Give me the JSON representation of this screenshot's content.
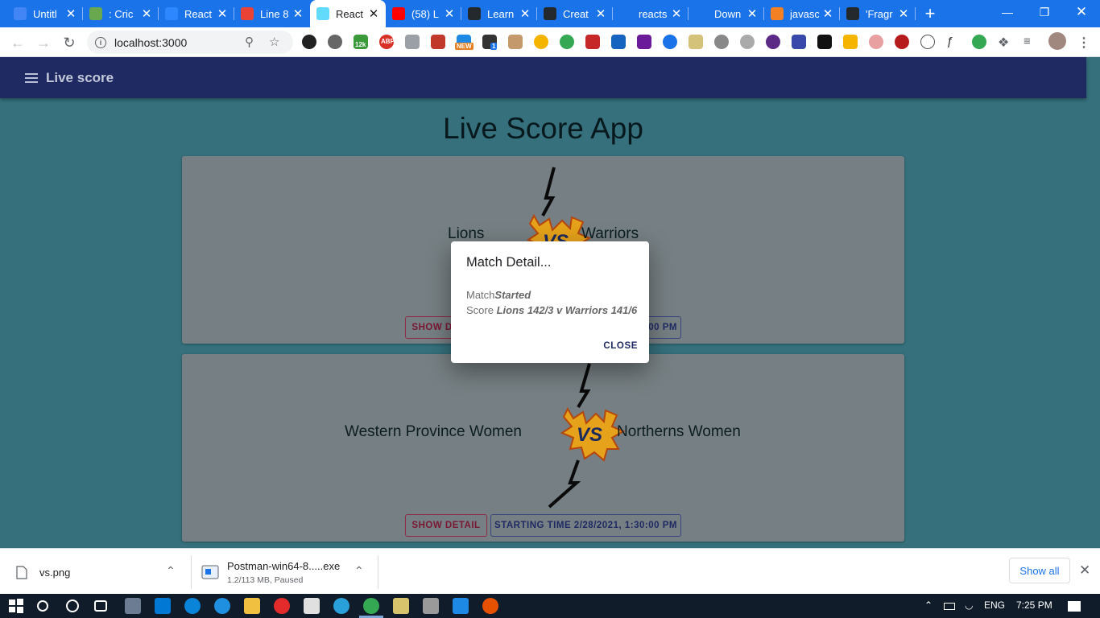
{
  "browser": {
    "tabs": [
      {
        "title": "Untitl",
        "icon": "docs-icon",
        "color": "#4285f4"
      },
      {
        "title": ": Cric",
        "icon": "cricket-icon",
        "color": "#6aa84f"
      },
      {
        "title": "React",
        "icon": "react-blue-icon",
        "color": "#2d88ff"
      },
      {
        "title": "Line 8",
        "icon": "google-icon",
        "color": "#ea4335"
      },
      {
        "title": "React",
        "icon": "react-icon",
        "color": "#61dafb"
      },
      {
        "title": "(58) L",
        "icon": "youtube-icon",
        "color": "#ff0000"
      },
      {
        "title": "Learn",
        "icon": "github-icon",
        "color": "#24292e"
      },
      {
        "title": "Creat",
        "icon": "github-icon",
        "color": "#24292e"
      },
      {
        "title": "reacts",
        "icon": "blank-icon",
        "color": "#1a73e8"
      },
      {
        "title": "Down",
        "icon": "person-icon",
        "color": "#1a73e8"
      },
      {
        "title": "javasc",
        "icon": "stack-icon",
        "color": "#f48024"
      },
      {
        "title": "'Fragr",
        "icon": "github-icon",
        "color": "#24292e"
      }
    ],
    "active_tab": 4,
    "close_symbol": "✕",
    "new_tab": "+",
    "url": "localhost:3000",
    "ext_badges": {
      "counter": "12k",
      "abp": "ABP",
      "new": "NEW",
      "one": "1"
    }
  },
  "app": {
    "bar_title": "Live score",
    "page_title": "Live Score App",
    "matches": [
      {
        "team1": "Lions",
        "team2": "Warriors",
        "detail_button": "SHOW DETAIL",
        "time_button": "STARTING TIME 2/28/2021, 1:30:00 PM"
      },
      {
        "team1": "Western Province Women",
        "team2": "Northerns Women",
        "detail_button": "SHOW DETAIL",
        "time_button": "STARTING TIME 2/28/2021, 1:30:00 PM"
      }
    ],
    "vs_text": "VS",
    "dialog": {
      "title": "Match Detail...",
      "match_label": "Match",
      "match_value": "Started",
      "score_label": "Score",
      "score_value": "Lions 142/3 v Warriors 141/6",
      "close_label": "CLOSE"
    }
  },
  "downloads": {
    "items": [
      {
        "name": "vs.png",
        "status": ""
      },
      {
        "name": "Postman-win64-8.....exe",
        "status": "1.2/113 MB, Paused"
      }
    ],
    "show_all": "Show all"
  },
  "taskbar": {
    "language": "ENG",
    "time": "7:25 PM"
  },
  "colors": {
    "appbar": "#1f2a63",
    "page_bg": "#35707c",
    "card": "#767f83",
    "detail_accent": "#7a1733",
    "chrome_blue": "#1a73e8"
  }
}
